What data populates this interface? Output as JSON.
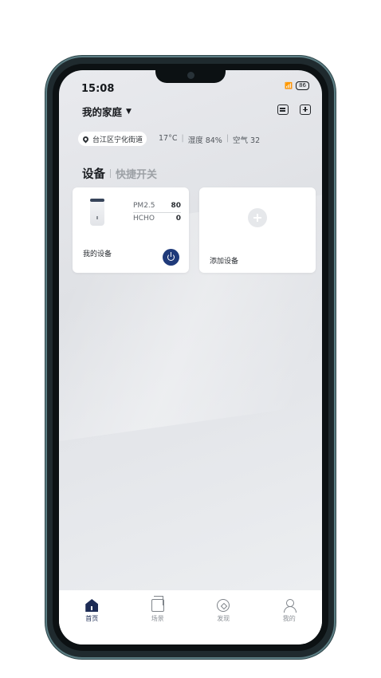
{
  "status_bar": {
    "time": "15:08",
    "battery": "86"
  },
  "header": {
    "home_title": "我的家庭"
  },
  "location": {
    "name": "台江区宁化街道"
  },
  "weather": {
    "temperature": "17°C",
    "humidity": "湿度 84%",
    "air": "空气 32"
  },
  "tabs": {
    "active": "设备",
    "inactive": "快捷开关"
  },
  "device_card": {
    "name": "我的设备",
    "readings": [
      {
        "label": "PM2.5",
        "value": "80"
      },
      {
        "label": "HCHO",
        "value": "0"
      }
    ]
  },
  "add_card": {
    "label": "添加设备"
  },
  "bottom_nav": [
    {
      "label": "首页",
      "icon": "home-icon",
      "active": true
    },
    {
      "label": "场景",
      "icon": "scene-icon",
      "active": false
    },
    {
      "label": "发现",
      "icon": "discover-icon",
      "active": false
    },
    {
      "label": "我的",
      "icon": "profile-icon",
      "active": false
    }
  ],
  "colors": {
    "accent": "#1d2c55",
    "power_button": "#1f3a7a"
  }
}
